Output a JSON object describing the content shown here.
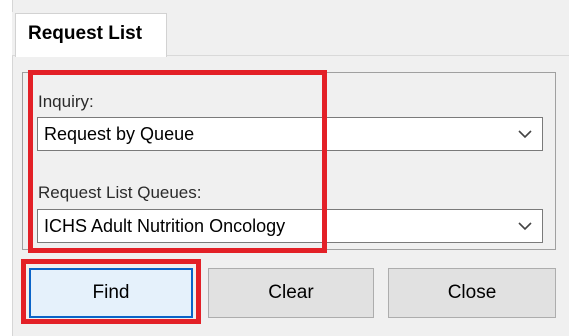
{
  "tabs": [
    {
      "label": "Request List"
    }
  ],
  "form": {
    "inquiry": {
      "label": "Inquiry:",
      "value": "Request by Queue"
    },
    "queues": {
      "label": "Request List Queues:",
      "value": "ICHS Adult Nutrition Oncology"
    }
  },
  "buttons": {
    "find": "Find",
    "clear": "Clear",
    "close": "Close"
  },
  "colors": {
    "highlight": "#e32027",
    "primary_border": "#0a64c8"
  }
}
